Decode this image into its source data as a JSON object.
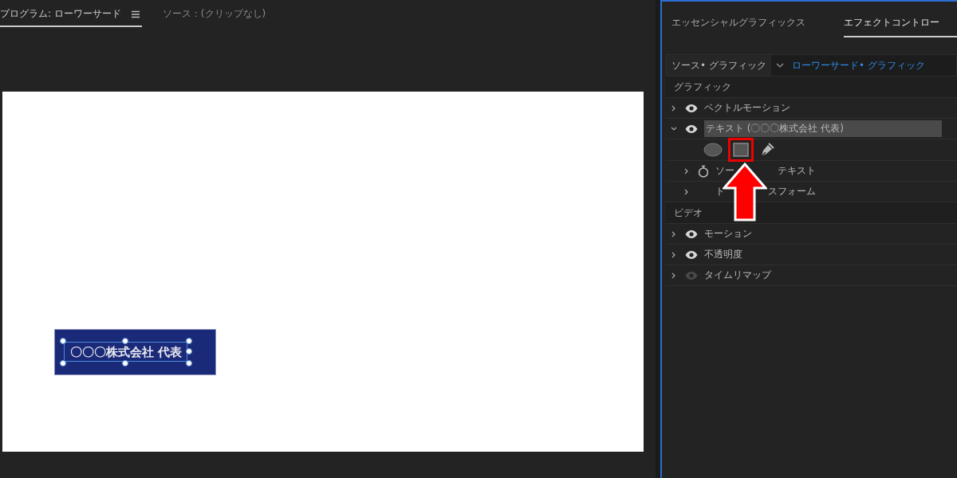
{
  "monitor_tabs": [
    {
      "label": "プログラム: ローワーサード",
      "selected": true,
      "has_menu": true
    },
    {
      "label": "ソース：(クリップなし)",
      "selected": false,
      "has_menu": false
    }
  ],
  "canvas": {
    "lower_third": {
      "text": "〇〇〇株式会社 代表",
      "selected": true
    }
  },
  "panel_tabs": [
    {
      "label": "エッセンシャルグラフィックス",
      "selected": false
    },
    {
      "label": "エフェクトコントロー",
      "selected": true
    }
  ],
  "source_row": {
    "source": "ソース• グラフィック",
    "clip": "ローワーサード• グラフィック"
  },
  "sections": [
    {
      "title": "グラフィック",
      "items": [
        {
          "label": "ベクトルモーション",
          "expanded": false,
          "visible": true,
          "highlighted": false
        },
        {
          "label": "テキスト (〇〇〇株式会社 代表)",
          "expanded": true,
          "visible": true,
          "highlighted": true,
          "tools": [
            {
              "kind": "ellipse",
              "selected": false
            },
            {
              "kind": "rectangle",
              "selected": true
            },
            {
              "kind": "pen",
              "selected": false
            }
          ],
          "children": [
            {
              "label_parts": [
                "ソー",
                "テキスト"
              ],
              "kind": "stopwatch"
            },
            {
              "label_parts": [
                "ト",
                "スフォーム"
              ],
              "kind": "plain"
            }
          ]
        }
      ]
    },
    {
      "title": "ビデオ",
      "items": [
        {
          "label": "モーション",
          "expanded": false,
          "visible": true,
          "highlighted": false
        },
        {
          "label": "不透明度",
          "expanded": false,
          "visible": true,
          "highlighted": false
        },
        {
          "label": "タイムリマップ",
          "expanded": false,
          "visible": false,
          "highlighted": false
        }
      ]
    }
  ]
}
